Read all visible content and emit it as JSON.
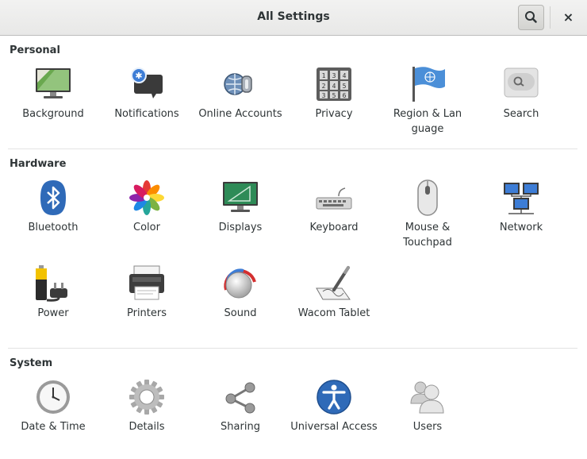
{
  "window": {
    "title": "All Settings",
    "search_icon": "search-icon",
    "close_symbol": "×"
  },
  "sections": {
    "personal": {
      "title": "Personal",
      "items": [
        {
          "label": "Background",
          "icon": "background-icon"
        },
        {
          "label": "Notifications",
          "icon": "notifications-icon"
        },
        {
          "label": "Online Accounts",
          "icon": "online-accounts-icon"
        },
        {
          "label": "Privacy",
          "icon": "privacy-icon"
        },
        {
          "label": "Region & Lan guage",
          "icon": "region-language-icon"
        },
        {
          "label": "Search",
          "icon": "search-settings-icon"
        }
      ]
    },
    "hardware": {
      "title": "Hardware",
      "items": [
        {
          "label": "Bluetooth",
          "icon": "bluetooth-icon"
        },
        {
          "label": "Color",
          "icon": "color-icon"
        },
        {
          "label": "Displays",
          "icon": "displays-icon"
        },
        {
          "label": "Keyboard",
          "icon": "keyboard-icon"
        },
        {
          "label": "Mouse & Touchpad",
          "icon": "mouse-icon"
        },
        {
          "label": "Network",
          "icon": "network-icon"
        },
        {
          "label": "Power",
          "icon": "power-icon"
        },
        {
          "label": "Printers",
          "icon": "printer-icon"
        },
        {
          "label": "Sound",
          "icon": "sound-icon"
        },
        {
          "label": "Wacom Tablet",
          "icon": "wacom-tablet-icon"
        }
      ]
    },
    "system": {
      "title": "System",
      "items": [
        {
          "label": "Date & Time",
          "icon": "clock-icon"
        },
        {
          "label": "Details",
          "icon": "gear-icon"
        },
        {
          "label": "Sharing",
          "icon": "share-icon"
        },
        {
          "label": "Universal Access",
          "icon": "accessibility-icon"
        },
        {
          "label": "Users",
          "icon": "users-icon"
        }
      ]
    }
  },
  "colors": {
    "header_bg": "#ececeb",
    "text": "#2e3436",
    "divider": "#e3e3e3"
  }
}
